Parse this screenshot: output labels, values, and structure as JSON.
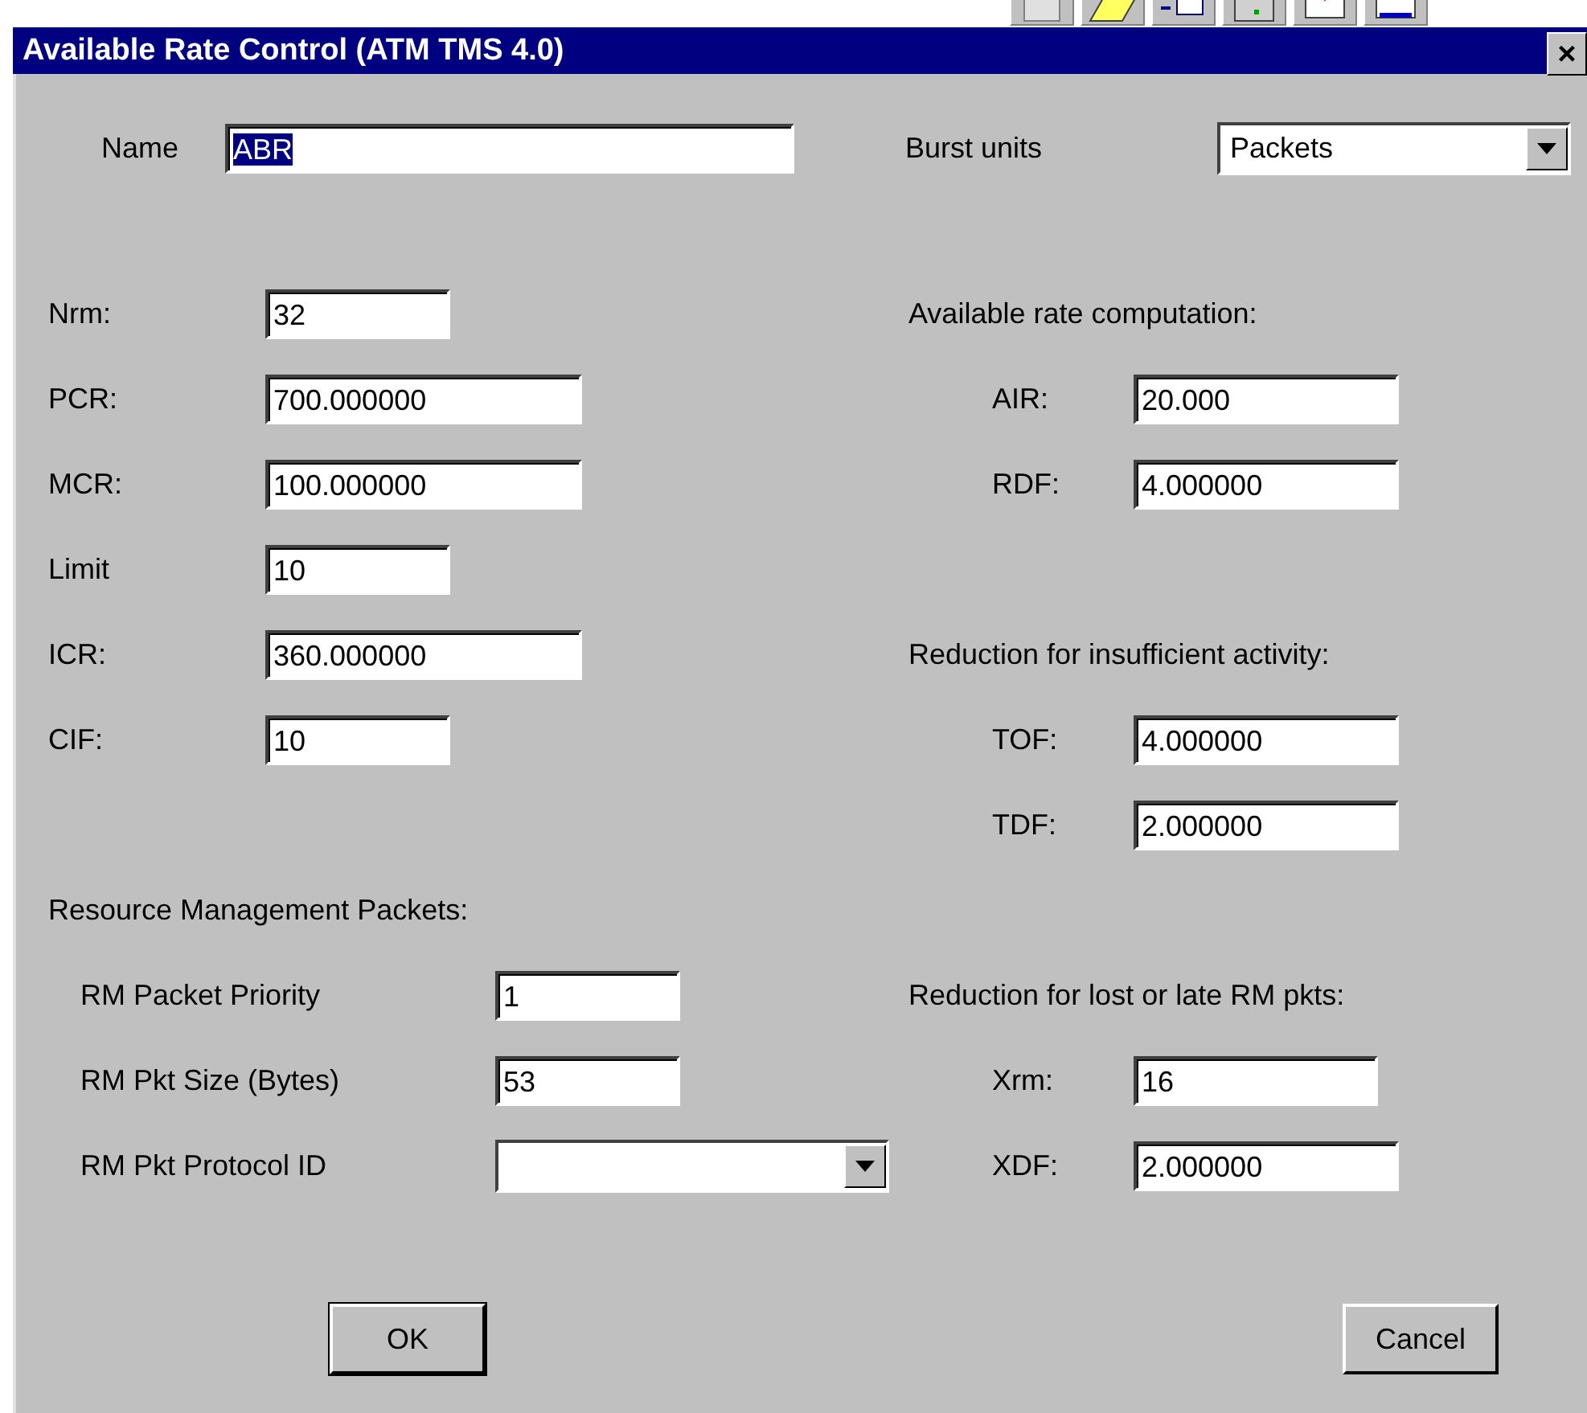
{
  "window": {
    "title": "Available Rate Control (ATM TMS 4.0)",
    "close": "×"
  },
  "name": {
    "label": "Name",
    "value": "ABR",
    "highlighted": true
  },
  "burst_units": {
    "label": "Burst units",
    "value": "Packets"
  },
  "left_groups": [
    {
      "fields": [
        {
          "kind": "text",
          "label": "Nrm:",
          "value": "32"
        },
        {
          "kind": "text",
          "label": "PCR:",
          "value": "700.000000"
        },
        {
          "kind": "text",
          "label": "MCR:",
          "value": "100.000000"
        },
        {
          "kind": "text",
          "label": "Limit",
          "value": "10"
        },
        {
          "kind": "text",
          "label": "ICR:",
          "value": "360.000000"
        },
        {
          "kind": "text",
          "label": "CIF:",
          "value": "10"
        }
      ]
    },
    {
      "heading": "Resource Management Packets:",
      "fields": [
        {
          "kind": "text",
          "label": "RM Packet Priority",
          "value": "1"
        },
        {
          "kind": "text",
          "label": "RM Pkt Size (Bytes)",
          "value": "53"
        },
        {
          "kind": "dropdown",
          "label": "RM Pkt Protocol ID"
        }
      ]
    }
  ],
  "right_groups": [
    {
      "heading": "Available rate computation:",
      "fields": [
        {
          "kind": "text",
          "label": "AIR:",
          "value": "20.000"
        },
        {
          "kind": "text",
          "label": "RDF:",
          "value": "4.000000"
        }
      ]
    },
    {
      "heading": "Reduction for insufficient activity:",
      "fields": [
        {
          "kind": "text",
          "label": "TOF:",
          "value": "4.000000"
        },
        {
          "kind": "text",
          "label": "TDF:",
          "value": "2.000000"
        }
      ]
    },
    {
      "heading": "Reduction for lost or late RM pkts:",
      "fields": [
        {
          "kind": "text",
          "label": "Xrm:",
          "value": "16"
        },
        {
          "kind": "text",
          "label": "XDF:",
          "value": "2.000000"
        }
      ]
    }
  ],
  "buttons": [
    "OK",
    "Cancel"
  ]
}
